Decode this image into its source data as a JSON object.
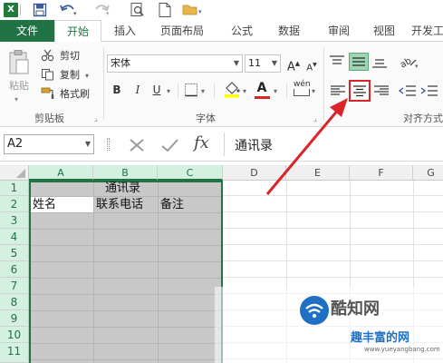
{
  "titlebar": {
    "app_icon": "X",
    "icons": [
      "excel-app-icon",
      "save-icon",
      "undo-icon",
      "redo-icon",
      "print-preview-icon",
      "new-file-icon",
      "open-folder-icon"
    ]
  },
  "ribbon_tabs": {
    "file": "文件",
    "home": "开始",
    "insert": "插入",
    "page_layout": "页面布局",
    "formulas": "公式",
    "data": "数据",
    "review": "审阅",
    "view": "视图",
    "developer": "开发工"
  },
  "clipboard": {
    "paste_label": "粘贴",
    "cut_label": "剪切",
    "copy_label": "复制",
    "format_painter_label": "格式刷",
    "group_label": "剪贴板"
  },
  "font": {
    "font_name": "宋体",
    "font_size": "11",
    "bold": "B",
    "italic": "I",
    "underline": "U",
    "grow": "A",
    "shrink": "A",
    "font_color_glyph": "A",
    "phonetic_label": "wén",
    "group_label": "字体"
  },
  "alignment": {
    "group_label": "对齐方式",
    "highlight_color": "#d9242a"
  },
  "formula_bar": {
    "name_box": "A2",
    "fx": "fx",
    "content": "通讯录"
  },
  "sheet": {
    "columns": [
      "A",
      "B",
      "C",
      "D",
      "E",
      "F",
      "G"
    ],
    "rows": [
      "1",
      "2",
      "3",
      "4",
      "5",
      "6",
      "7",
      "8",
      "9",
      "10",
      "11"
    ],
    "cells": {
      "b1": "通讯录",
      "a2": "姓名",
      "b2": "联系电话",
      "c2": "备注"
    },
    "selection_fill": "#c8c8c8",
    "selection_border": "#217346"
  },
  "watermark": {
    "brand": "酷知网",
    "brand_sub": "趣丰富的网",
    "url": "www.yueyangbang.com"
  },
  "annotation": {
    "arrow_color": "#d9242a"
  }
}
